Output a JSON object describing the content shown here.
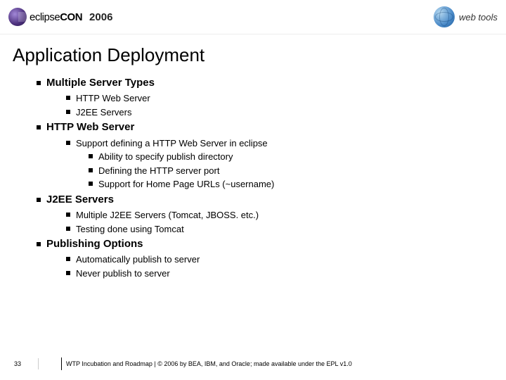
{
  "header": {
    "brand_pre": "eclipse",
    "brand_post": "CON",
    "year": "2006",
    "right_label": "web tools"
  },
  "title": "Application Deployment",
  "sections": [
    {
      "heading": "Multiple Server Types",
      "items": [
        {
          "text": "HTTP Web Server"
        },
        {
          "text": "J2EE Servers"
        }
      ]
    },
    {
      "heading": "HTTP Web Server",
      "items": [
        {
          "text": "Support defining a HTTP Web Server in eclipse",
          "sub": [
            "Ability to specify publish directory",
            "Defining the HTTP server port",
            "Support for Home Page URLs (~username)"
          ]
        }
      ]
    },
    {
      "heading": "J2EE Servers",
      "items": [
        {
          "text": "Multiple J2EE Servers (Tomcat, JBOSS. etc.)"
        },
        {
          "text": "Testing done using Tomcat"
        }
      ]
    },
    {
      "heading": "Publishing Options",
      "items": [
        {
          "text": "Automatically publish to server"
        },
        {
          "text": "Never publish to server"
        }
      ]
    }
  ],
  "footer": {
    "page": "33",
    "text": "WTP Incubation and Roadmap  |  © 2006 by BEA, IBM, and Oracle; made available under the EPL v1.0"
  }
}
